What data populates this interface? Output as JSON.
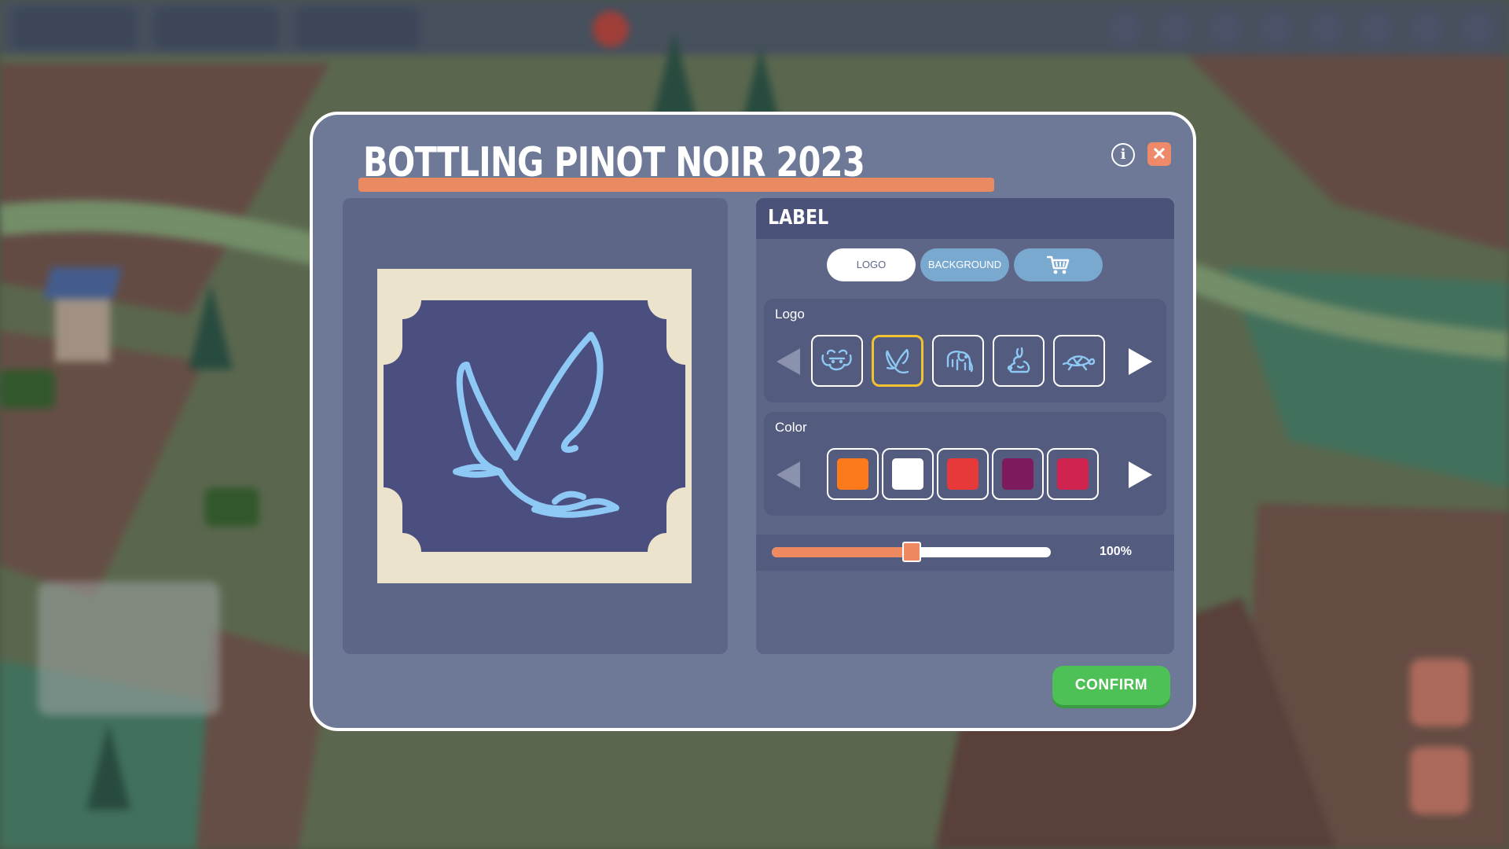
{
  "modal": {
    "title": "BOTTLING PINOT NOIR 2023",
    "info_icon": "info-icon",
    "close_icon": "close-icon"
  },
  "label_panel": {
    "title": "LABEL",
    "tabs": [
      {
        "label": "LOGO",
        "active": true
      },
      {
        "label": "BACKGROUND",
        "active": false
      },
      {
        "label": "",
        "icon": "shopping-cart-icon",
        "active": false
      }
    ]
  },
  "logo_section": {
    "title": "Logo",
    "items": [
      {
        "icon": "bull-icon",
        "selected": false
      },
      {
        "icon": "bird-icon",
        "selected": true
      },
      {
        "icon": "elephant-icon",
        "selected": false
      },
      {
        "icon": "rabbit-icon",
        "selected": false
      },
      {
        "icon": "turtle-icon",
        "selected": false
      }
    ]
  },
  "color_section": {
    "title": "Color",
    "swatches": [
      "#fd7a1c",
      "#ffffff",
      "#e8393a",
      "#7e1b5c",
      "#cf2350"
    ]
  },
  "size_slider": {
    "value_label": "100%",
    "fraction": 0.5
  },
  "preview": {
    "label_bg_color": "#ebe3cc",
    "badge_color": "#4b4f80",
    "logo_color": "#8ec8f4",
    "logo_icon": "bird-icon"
  },
  "confirm_button": {
    "label": "CONFIRM"
  },
  "colors": {
    "accent": "#ee8a62",
    "confirm": "#4ec156",
    "selection": "#f2c230"
  }
}
